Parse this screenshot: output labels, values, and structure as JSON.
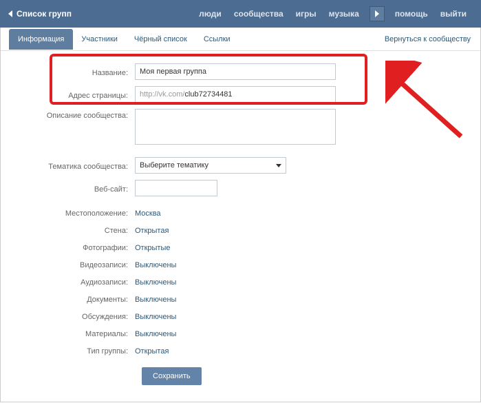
{
  "topbar": {
    "back_label": "Список групп",
    "nav": {
      "people": "люди",
      "communities": "сообщества",
      "games": "игры",
      "music": "музыка",
      "help": "помощь",
      "logout": "выйти"
    }
  },
  "tabs": {
    "info": "Информация",
    "members": "Участники",
    "blacklist": "Чёрный список",
    "links": "Ссылки",
    "back": "Вернуться к сообществу"
  },
  "form": {
    "name_label": "Название:",
    "name_value": "Моя первая группа",
    "address_label": "Адрес страницы:",
    "address_prefix": "http://vk.com/",
    "address_value": "club72734481",
    "desc_label": "Описание сообщества:",
    "desc_value": "",
    "topic_label": "Тематика сообщества:",
    "topic_value": "Выберите тематику",
    "website_label": "Веб-сайт:",
    "website_value": "",
    "location_label": "Местоположение:",
    "location_value": "Москва",
    "wall_label": "Стена:",
    "wall_value": "Открытая",
    "photos_label": "Фотографии:",
    "photos_value": "Открытые",
    "videos_label": "Видеозаписи:",
    "videos_value": "Выключены",
    "audios_label": "Аудиозаписи:",
    "audios_value": "Выключены",
    "docs_label": "Документы:",
    "docs_value": "Выключены",
    "discussions_label": "Обсуждения:",
    "discussions_value": "Выключены",
    "materials_label": "Материалы:",
    "materials_value": "Выключены",
    "group_type_label": "Тип группы:",
    "group_type_value": "Открытая",
    "save_label": "Сохранить"
  }
}
